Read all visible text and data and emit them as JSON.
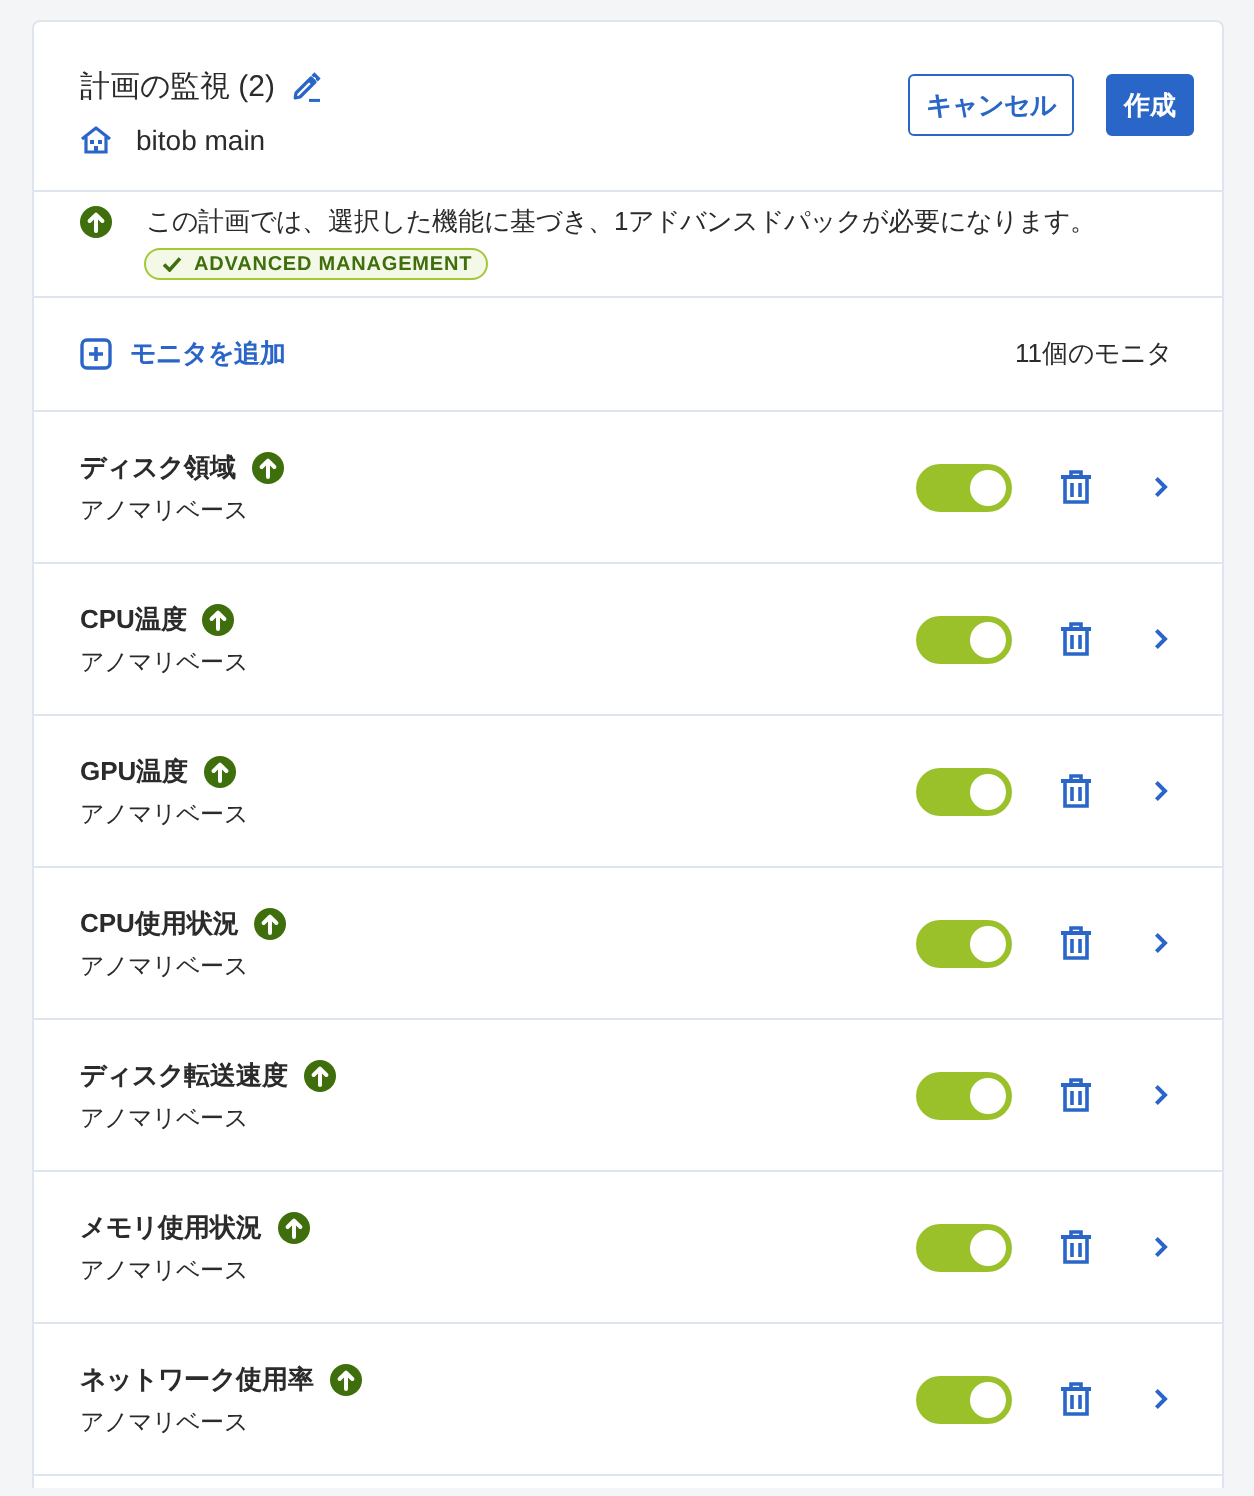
{
  "header": {
    "title": "計画の監視 (2)",
    "location": "bitob main",
    "buttons": [
      {
        "label": "キャンセル",
        "kind": "secondary"
      },
      {
        "label": "作成",
        "kind": "primary"
      }
    ]
  },
  "notice": {
    "text": "この計画では、選択した機能に基づき、1アドバンスドパックが必要になります。",
    "badge": "ADVANCED MANAGEMENT"
  },
  "toolbar": {
    "add_label": "モニタを追加",
    "count": "11個のモニタ"
  },
  "monitors": [
    {
      "name": "ディスク領域",
      "type": "アノマリベース",
      "upgrade": true,
      "on": true
    },
    {
      "name": "CPU温度",
      "type": "アノマリベース",
      "upgrade": true,
      "on": true
    },
    {
      "name": "GPU温度",
      "type": "アノマリベース",
      "upgrade": true,
      "on": true
    },
    {
      "name": "CPU使用状況",
      "type": "アノマリベース",
      "upgrade": true,
      "on": true
    },
    {
      "name": "ディスク転送速度",
      "type": "アノマリベース",
      "upgrade": true,
      "on": true
    },
    {
      "name": "メモリ使用状況",
      "type": "アノマリベース",
      "upgrade": true,
      "on": true
    },
    {
      "name": "ネットワーク使用率",
      "type": "アノマリベース",
      "upgrade": true,
      "on": true
    }
  ]
}
